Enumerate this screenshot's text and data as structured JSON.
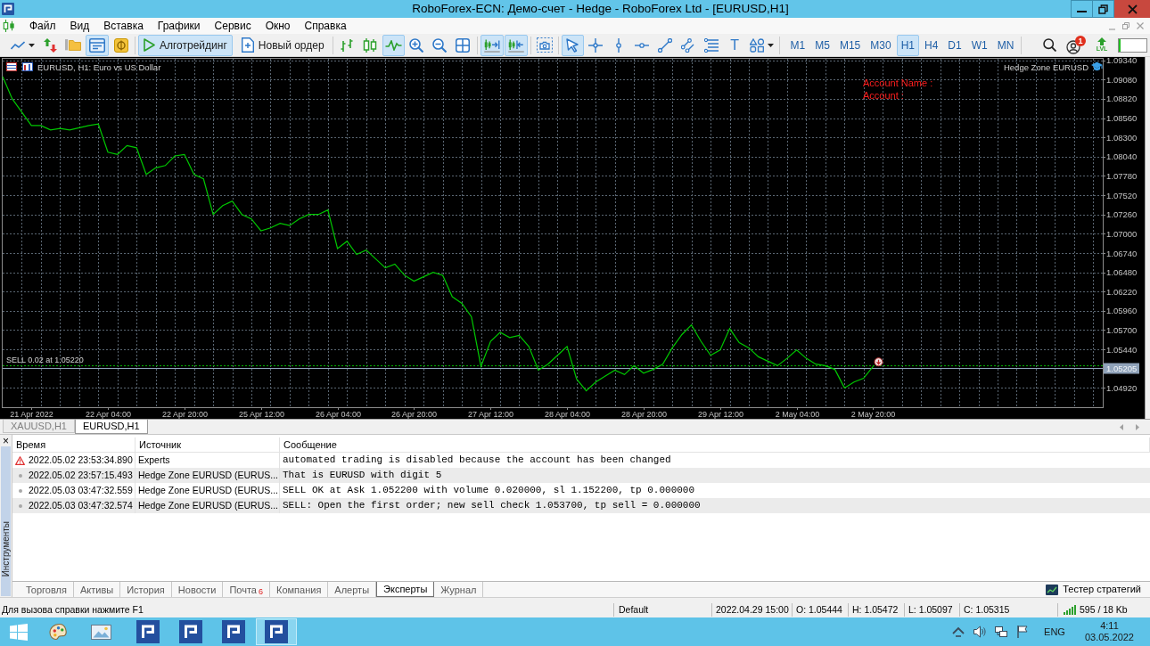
{
  "window": {
    "title": "RoboForex-ECN: Демо-счет - Hedge - RoboForex Ltd - [EURUSD,H1]"
  },
  "menu": {
    "items": [
      "Файл",
      "Вид",
      "Вставка",
      "Графики",
      "Сервис",
      "Окно",
      "Справка"
    ]
  },
  "toolbar": {
    "file_tools": [
      {
        "selected": false
      },
      {
        "selected": false
      },
      {
        "selected": false
      },
      {
        "selected": true
      },
      {
        "selected": false
      }
    ],
    "buttons": [
      {
        "label": "Алготрейдинг",
        "selected": true
      },
      {
        "label": "Новый ордер",
        "selected": false
      }
    ],
    "chart_tools": [
      {
        "selected": false
      },
      {
        "selected": false
      },
      {
        "selected": true
      },
      {
        "selected": false
      },
      {
        "selected": false
      },
      {
        "selected": false
      }
    ],
    "scroll_tools": [
      {
        "selected": true
      },
      {
        "selected": true
      }
    ],
    "capture_tools": [
      {
        "selected": false
      }
    ],
    "drawing_tools": [
      {
        "kind": "icon",
        "selected": true
      },
      {
        "kind": "icon",
        "selected": false
      },
      {
        "kind": "icon",
        "selected": false
      },
      {
        "kind": "icon",
        "selected": false
      },
      {
        "kind": "icon",
        "selected": false
      },
      {
        "kind": "icon",
        "selected": false
      },
      {
        "kind": "icon",
        "selected": false
      },
      {
        "kind": "text",
        "label": "T",
        "selected": false
      },
      {
        "kind": "icon",
        "selected": false
      }
    ],
    "timeframes": [
      {
        "label": "M1",
        "selected": false
      },
      {
        "label": "M5",
        "selected": false
      },
      {
        "label": "M15",
        "selected": false
      },
      {
        "label": "M30",
        "selected": false
      },
      {
        "label": "H1",
        "selected": true
      },
      {
        "label": "H4",
        "selected": false
      },
      {
        "label": "D1",
        "selected": false
      },
      {
        "label": "W1",
        "selected": false
      },
      {
        "label": "MN",
        "selected": false
      }
    ],
    "notification_count": "1",
    "level_badge": "LVL",
    "level_meter": {
      "level": 0.08
    }
  },
  "chart": {
    "expert": "Hedge Zone EURUSD",
    "account_labels": [
      "Account Name :",
      "Account :"
    ],
    "chart_data": [
      {
        "type": "line",
        "title": "EURUSD, H1: Euro vs US Dollar",
        "categories": [
          null,
          null,
          null,
          "21 Apr 2022",
          null,
          null,
          null,
          null,
          null,
          null,
          null,
          "22 Apr 04:00",
          null,
          null,
          null,
          null,
          null,
          null,
          null,
          "22 Apr 20:00",
          null,
          null,
          null,
          null,
          null,
          null,
          null,
          "25 Apr 12:00",
          null,
          null,
          null,
          null,
          null,
          null,
          null,
          "26 Apr 04:00",
          null,
          null,
          null,
          null,
          null,
          null,
          null,
          "26 Apr 20:00",
          null,
          null,
          null,
          null,
          null,
          null,
          null,
          "27 Apr 12:00",
          null,
          null,
          null,
          null,
          null,
          null,
          null,
          "28 Apr 04:00",
          null,
          null,
          null,
          null,
          null,
          null,
          null,
          "28 Apr 20:00",
          null,
          null,
          null,
          null,
          null,
          null,
          null,
          "29 Apr 12:00",
          null,
          null,
          null,
          null,
          null,
          null,
          null,
          "2 May 04:00",
          null,
          null,
          null,
          null,
          null,
          null,
          null,
          "2 May 20:00"
        ],
        "values": [
          1.0912,
          1.0882,
          1.0864,
          1.0846,
          1.0846,
          1.084,
          1.0842,
          1.084,
          1.0843,
          1.0846,
          1.0848,
          1.081,
          1.0807,
          1.0819,
          1.0816,
          1.078,
          1.0789,
          1.0792,
          1.0805,
          1.0807,
          1.078,
          1.0774,
          1.0726,
          1.0738,
          1.0744,
          1.0726,
          1.072,
          1.0704,
          1.0708,
          1.0714,
          1.0711,
          1.072,
          1.0726,
          1.0726,
          1.0732,
          1.068,
          1.069,
          1.0672,
          1.0678,
          1.0666,
          1.0654,
          1.0659,
          1.0644,
          1.0636,
          1.0642,
          1.0648,
          1.0644,
          1.0615,
          1.0606,
          1.0588,
          1.0521,
          1.0555,
          1.0567,
          1.056,
          1.0563,
          1.0548,
          1.0516,
          1.0524,
          1.0536,
          1.0548,
          1.0504,
          1.0488,
          1.05,
          1.0508,
          1.0516,
          1.051,
          1.0522,
          1.0512,
          1.0517,
          1.0524,
          1.0546,
          1.0564,
          1.0577,
          1.0555,
          1.0536,
          1.0543,
          1.0572,
          1.0553,
          1.0546,
          1.0534,
          1.0528,
          1.0522,
          1.0532,
          1.0543,
          1.0532,
          1.0524,
          1.0522,
          1.0517,
          1.0492,
          1.05,
          1.0505,
          1.0521
        ],
        "color": "#00c800",
        "ylim": [
          1.0466,
          1.0936
        ],
        "yticks": [
          {
            "value": 1.0934,
            "label": "1.09340"
          },
          {
            "value": 1.0908,
            "label": "1.09080"
          },
          {
            "value": 1.0882,
            "label": "1.08820"
          },
          {
            "value": 1.0856,
            "label": "1.08560"
          },
          {
            "value": 1.083,
            "label": "1.08300"
          },
          {
            "value": 1.0804,
            "label": "1.08040"
          },
          {
            "value": 1.0778,
            "label": "1.07780"
          },
          {
            "value": 1.0752,
            "label": "1.07520"
          },
          {
            "value": 1.0726,
            "label": "1.07260"
          },
          {
            "value": 1.07,
            "label": "1.07000"
          },
          {
            "value": 1.0674,
            "label": "1.06740"
          },
          {
            "value": 1.0648,
            "label": "1.06480"
          },
          {
            "value": 1.0622,
            "label": "1.06220"
          },
          {
            "value": 1.0596,
            "label": "1.05960"
          },
          {
            "value": 1.057,
            "label": "1.05700"
          },
          {
            "value": 1.0544,
            "label": "1.05440"
          },
          {
            "value": 1.0492,
            "label": "1.04920"
          }
        ],
        "grid": true,
        "ref_lines": [
          {
            "axis": "y",
            "value": 1.0522,
            "label": "SELL 0.02 at 1.05220",
            "color": "#00b000",
            "line_style": "dotted"
          },
          {
            "axis": "y",
            "value": 1.05205,
            "label": "1.05205",
            "color": "#8fa2b9",
            "line_style": "solid"
          }
        ]
      }
    ]
  },
  "chart_tabs": [
    {
      "label": "XAUUSD,H1",
      "selected": false
    },
    {
      "label": "EURUSD,H1",
      "selected": true
    }
  ],
  "toolbox": {
    "close": "×",
    "title": "Инструменты",
    "columns": [
      "Время",
      "Источник",
      "Сообщение"
    ],
    "rows": [
      {
        "kind": "warning",
        "time": "2022.05.02 23:53:34.890",
        "source": "Experts",
        "message": "automated trading is disabled because the account has been changed"
      },
      {
        "kind": "info",
        "time": "2022.05.02 23:57:15.493",
        "source": "Hedge Zone EURUSD (EURUS...",
        "message": "That is EURUSD with digit 5"
      },
      {
        "kind": "info",
        "time": "2022.05.03 03:47:32.559",
        "source": "Hedge Zone EURUSD (EURUS...",
        "message": "SELL OK at Ask 1.052200 with volume 0.020000, sl 1.152200, tp 0.000000"
      },
      {
        "kind": "info",
        "time": "2022.05.03 03:47:32.574",
        "source": "Hedge Zone EURUSD (EURUS...",
        "message": "SELL: Open the first order; new sell check 1.053700, tp sell = 0.000000"
      }
    ],
    "tabs": [
      {
        "label": "Торговля",
        "selected": false
      },
      {
        "label": "Активы",
        "selected": false
      },
      {
        "label": "История",
        "selected": false
      },
      {
        "label": "Новости",
        "selected": false
      },
      {
        "label": "Почта",
        "badge": "6",
        "selected": false
      },
      {
        "label": "Компания",
        "selected": false
      },
      {
        "label": "Алерты",
        "selected": false
      },
      {
        "label": "Эксперты",
        "selected": true
      },
      {
        "label": "Журнал",
        "selected": false
      }
    ],
    "tester": "Тестер стратегий"
  },
  "status_bar": {
    "hint": "Для вызова справки нажмите F1",
    "profile": "Default",
    "bar_time": "2022.04.29 15:00",
    "open": "O: 1.05444",
    "high": "H: 1.05472",
    "low": "L: 1.05097",
    "close": "C: 1.05315",
    "traffic": "595 / 18 Kb"
  },
  "taskbar": {
    "windows": [
      {
        "selected": false
      },
      {
        "selected": false
      },
      {
        "selected": false
      },
      {
        "selected": true
      }
    ],
    "language": "ENG",
    "time": "4:11",
    "date": "03.05.2022"
  }
}
